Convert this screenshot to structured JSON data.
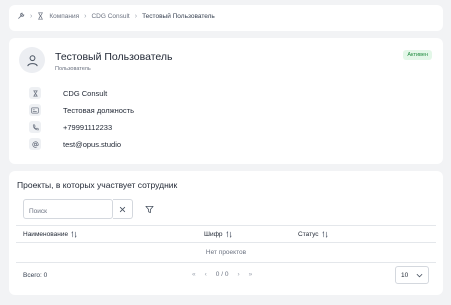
{
  "breadcrumb": {
    "items": [
      {
        "label": "Компания"
      },
      {
        "label": "CDG Consult"
      },
      {
        "label": "Тестовый Пользователь"
      }
    ]
  },
  "profile": {
    "name": "Тестовый Пользователь",
    "role": "Пользователь",
    "status_badge": "Активен",
    "status_color": "#1e8a3e",
    "details": [
      {
        "icon": "building-icon",
        "value": "CDG Consult"
      },
      {
        "icon": "id-card-icon",
        "value": "Тестовая должность"
      },
      {
        "icon": "phone-icon",
        "value": "+79991112233"
      },
      {
        "icon": "email-icon",
        "value": "test@opus.studio"
      }
    ]
  },
  "projects": {
    "title": "Проекты, в которых участвует сотрудник",
    "search": {
      "placeholder": "Поиск",
      "value": ""
    },
    "columns": [
      {
        "label": "Наименование"
      },
      {
        "label": "Шифр"
      },
      {
        "label": "Статус"
      }
    ],
    "empty_text": "Нет проектов",
    "total_label": "Всего: 0",
    "pagination": {
      "info": "0 / 0"
    },
    "page_size": "10"
  }
}
